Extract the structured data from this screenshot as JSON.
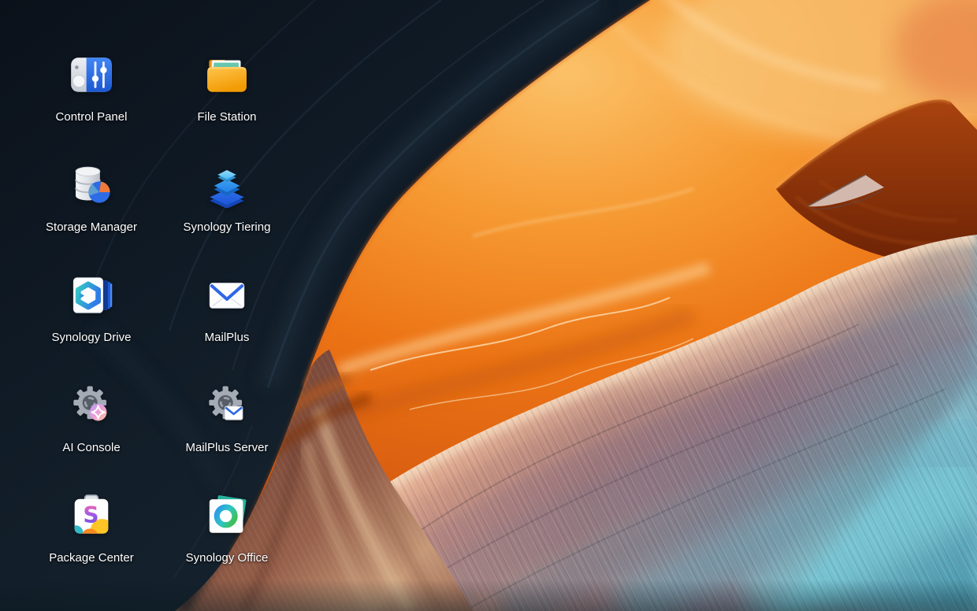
{
  "desktop": {
    "icons": [
      {
        "label": "Control Panel",
        "icon": "control-panel-icon"
      },
      {
        "label": "File Station",
        "icon": "file-station-icon"
      },
      {
        "label": "Storage Manager",
        "icon": "storage-manager-icon"
      },
      {
        "label": "Synology Tiering",
        "icon": "synology-tiering-icon"
      },
      {
        "label": "Synology Drive",
        "icon": "synology-drive-icon"
      },
      {
        "label": "MailPlus",
        "icon": "mailplus-icon"
      },
      {
        "label": "AI Console",
        "icon": "ai-console-icon"
      },
      {
        "label": "MailPlus Server",
        "icon": "mailplus-server-icon"
      },
      {
        "label": "Package Center",
        "icon": "package-center-icon"
      },
      {
        "label": "Synology Office",
        "icon": "synology-office-icon"
      }
    ],
    "wallpaper": {
      "description": "Slot canyon photograph: dark slate rock wall on the left, glowing orange sandstone in the upper middle, dark rust bowl at top right, and a striated salmon-mauve slope sweeping to a cyan shadow in the lower right corner.",
      "palette": {
        "dark_wall": "#0e1821",
        "orange": "#ec7415",
        "gold_highlight": "#f9c97e",
        "rust_bowl": "#7c2a08",
        "salmon_slope": "#e8b79e",
        "mauve_slope": "#8a7686",
        "cyan_shadow": "#5fb7cc",
        "brown_wall": "#7c4c3a"
      }
    }
  }
}
